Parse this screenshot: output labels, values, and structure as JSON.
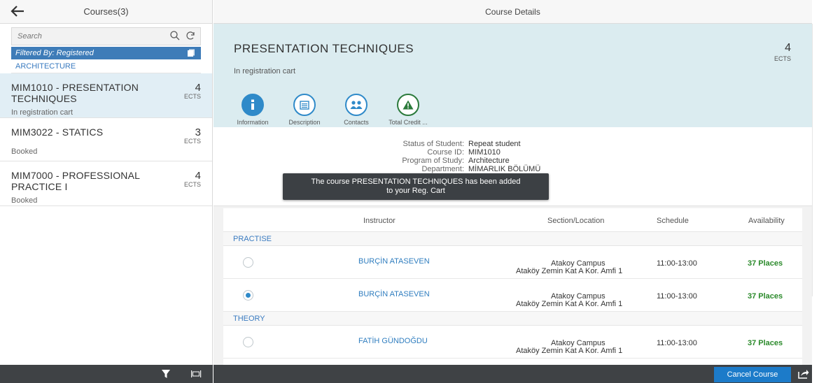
{
  "master": {
    "title": "Courses(3)",
    "search_placeholder": "Search",
    "filter_text": "Filtered By: Registered",
    "group": "ARCHITECTURE",
    "courses": [
      {
        "title": "MIM1010 - PRESENTATION TECHNIQUES",
        "ects": "4",
        "ects_unit": "ECTS",
        "status": "In registration cart",
        "selected": true
      },
      {
        "title": "MIM3022 - STATICS",
        "ects": "3",
        "ects_unit": "ECTS",
        "status": "Booked",
        "selected": false
      },
      {
        "title": "MIM7000 - PROFESSIONAL PRACTICE I",
        "ects": "4",
        "ects_unit": "ECTS",
        "status": "Booked",
        "selected": false
      }
    ]
  },
  "detail": {
    "header": "Course Details",
    "course_title": "PRESENTATION TECHNIQUES",
    "course_status": "In registration cart",
    "ects": "4",
    "ects_unit": "ECTS",
    "tabs": [
      {
        "label": "Information",
        "icon": "info-icon",
        "active": true
      },
      {
        "label": "Description",
        "icon": "calendar-icon",
        "active": false
      },
      {
        "label": "Contacts",
        "icon": "people-icon",
        "active": false
      },
      {
        "label": "Total Credit ...",
        "icon": "warning-icon",
        "active": false
      }
    ],
    "info": [
      {
        "label": "Status of Student:",
        "value": "Repeat student"
      },
      {
        "label": "Course ID:",
        "value": "MIM1010"
      },
      {
        "label": "Program of Study:",
        "value": "Architecture"
      },
      {
        "label": "Department:",
        "value": "MİMARLIK BÖLÜMÜ"
      }
    ],
    "toast_line1": "The course PRESENTATION TECHNIQUES has been added",
    "toast_line2": "to your Reg. Cart",
    "table": {
      "columns": {
        "instructor": "Instructor",
        "section": "Section/Location",
        "schedule": "Schedule",
        "availability": "Availability"
      },
      "groups": [
        {
          "name": "PRACTISE",
          "rows": [
            {
              "selected": false,
              "instructor": "BURÇİN ATASEVEN",
              "location1": "Atakoy Campus",
              "location2": "Ataköy Zemin Kat A Kor. Amfi 1",
              "schedule": "11:00-13:00",
              "availability": "37 Places"
            },
            {
              "selected": true,
              "instructor": "BURÇİN ATASEVEN",
              "location1": "Atakoy Campus",
              "location2": "Ataköy Zemin Kat A Kor. Amfi 1",
              "schedule": "11:00-13:00",
              "availability": "37 Places"
            }
          ]
        },
        {
          "name": "THEORY",
          "rows": [
            {
              "selected": false,
              "instructor": "FATİH GÜNDOĞDU",
              "location1": "Atakoy Campus",
              "location2": "Ataköy Zemin Kat A Kor. Amfi 1",
              "schedule": "11:00-13:00",
              "availability": "37 Places"
            }
          ]
        }
      ]
    },
    "cancel_label": "Cancel Course"
  },
  "colors": {
    "accent": "#2f8ac9",
    "filter_bar": "#3e7cb8",
    "available": "#2b8a2b",
    "footer": "#3f4245",
    "object_header": "#dbecf0"
  }
}
